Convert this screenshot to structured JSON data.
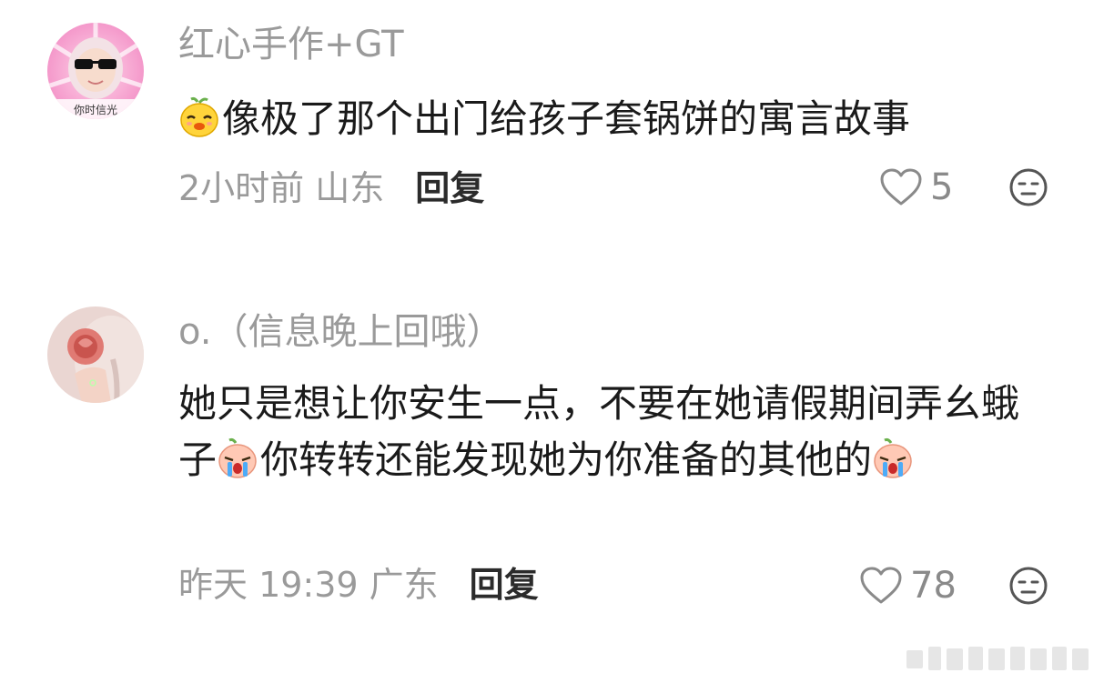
{
  "comments": [
    {
      "username": "红心手作+GT",
      "avatar_caption": "你时信光",
      "text_segments": [
        "像极了那个出门给孩子套锅饼的寓言故事"
      ],
      "emoji": "smug-face-emoji",
      "time": "2小时前",
      "location": "山东",
      "reply_label": "回复",
      "like_count": "5"
    },
    {
      "username": "o.（信息晚上回哦）",
      "text_segments": [
        "她只是想让你安生一点，不要在她请假期间弄幺蛾子",
        "你转转还能发现她为你准备的其他的"
      ],
      "emoji": "crying-face-emoji",
      "time": "昨天 19:39",
      "location": "广东",
      "reply_label": "回复",
      "like_count": "78"
    }
  ],
  "icons": {
    "like": "heart-outline-icon",
    "dislike": "neutral-face-icon"
  },
  "colors": {
    "username": "#9a9a9a",
    "text": "#1a1a1a",
    "meta": "#9a9a9a",
    "reply": "#2b2b2b"
  }
}
